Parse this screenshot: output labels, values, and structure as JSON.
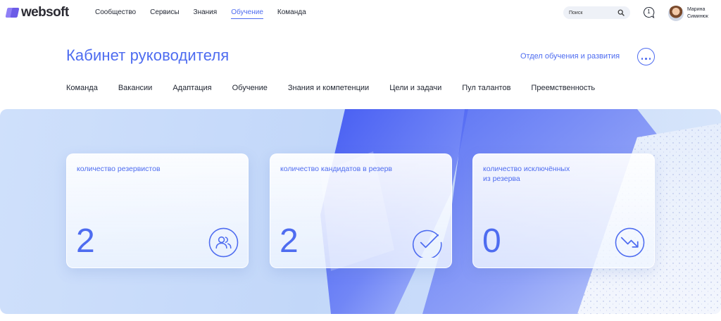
{
  "brand": {
    "name": "websoft"
  },
  "topnav": {
    "items": [
      {
        "label": "Сообщество"
      },
      {
        "label": "Сервисы"
      },
      {
        "label": "Знания"
      },
      {
        "label": "Обучение"
      },
      {
        "label": "Команда"
      }
    ],
    "active": "Обучение"
  },
  "search": {
    "placeholder": "Поиск"
  },
  "notifications": {
    "count": "1"
  },
  "user": {
    "first_name": "Марина",
    "last_name": "Симинюк"
  },
  "header": {
    "title": "Кабинет руководителя",
    "department": "Отдел обучения и развития"
  },
  "tabs": [
    {
      "label": "Команда"
    },
    {
      "label": "Вакансии"
    },
    {
      "label": "Адаптация"
    },
    {
      "label": "Обучение"
    },
    {
      "label": "Знания и компетенции"
    },
    {
      "label": "Цели и задачи"
    },
    {
      "label": "Пул талантов"
    },
    {
      "label": "Преемственность"
    }
  ],
  "cards": [
    {
      "label": "количество резервистов",
      "value": "2",
      "icon": "users-icon"
    },
    {
      "label": "количество кандидатов в резерв",
      "value": "2",
      "icon": "check-circle-icon"
    },
    {
      "label": "количество исключённых из резерва",
      "value": "0",
      "icon": "trend-down-icon"
    }
  ],
  "colors": {
    "accent": "#4e6cf0",
    "banner": "#c9dcfa",
    "text": "#1f2430"
  }
}
